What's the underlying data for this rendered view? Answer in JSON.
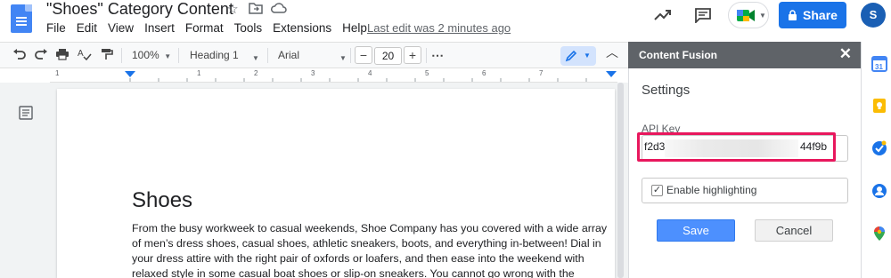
{
  "header": {
    "doc_title": "\"Shoes\" Category Content",
    "menu": [
      "File",
      "Edit",
      "View",
      "Insert",
      "Format",
      "Tools",
      "Extensions",
      "Help"
    ],
    "last_edit": "Last edit was 2 minutes ago",
    "share_label": "Share",
    "avatar_letter": "S"
  },
  "toolbar": {
    "zoom": "100%",
    "style": "Heading 1",
    "font": "Arial",
    "font_size": "20",
    "minus": "−",
    "plus": "+",
    "more": "⋯"
  },
  "ruler": {
    "numbers": [
      "1",
      "1",
      "2",
      "3",
      "4",
      "5",
      "6",
      "7"
    ]
  },
  "document": {
    "heading": "Shoes",
    "body": "From the busy workweek to casual weekends, Shoe Company has you covered with a wide array of men’s dress shoes, casual shoes, athletic sneakers, boots, and everything in-between! Dial in your dress attire with the right pair of oxfords or loafers, and then ease into the weekend with relaxed style in some casual boat shoes or slip-on sneakers. You cannot go wrong with the"
  },
  "sidebar": {
    "title": "Content Fusion",
    "close": "✕",
    "settings_heading": "Settings",
    "api_key_label": "API Key",
    "api_key_prefix": "f2d3",
    "api_key_suffix": "44f9b",
    "enable_highlighting_label": "Enable highlighting",
    "enable_highlighting_checked": true,
    "save_label": "Save",
    "cancel_label": "Cancel"
  },
  "colors": {
    "share_blue": "#1a73e8",
    "sidebar_header": "#5f6368",
    "save_blue": "#4d90fe",
    "highlight_red": "#e8175d"
  }
}
